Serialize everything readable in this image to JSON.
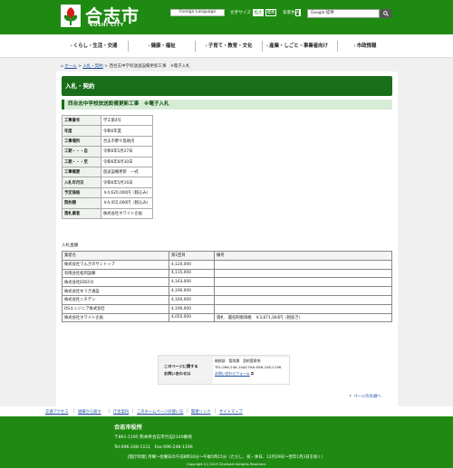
{
  "header": {
    "logo_name": "合志市",
    "logo_en": "KOSHI CITY",
    "foreign_language": "Foreign Language",
    "font_size_label": "文字サイズ",
    "font_enlarge": "拡大",
    "font_standard": "標準",
    "bg_color_label": "背景色",
    "bg_options": [
      "A",
      "A",
      "A"
    ],
    "search_placeholder": "Google 提供"
  },
  "nav": {
    "items": [
      "くらし・生活・交通",
      "健康・福祉",
      "子育て・教育・文化",
      "産業・しごと・事業者向け",
      "市政情報"
    ]
  },
  "breadcrumb": {
    "home": "ホーム",
    "level1": "入札・契約",
    "current": "西合志中学校放送設備更新工事　※電子入札"
  },
  "page": {
    "title": "入札・契約",
    "subtitle": "西合志中学校放送設備更新工事　※電子入札"
  },
  "info_table": [
    {
      "key": "工事番号",
      "value": "学工第4号"
    },
    {
      "key": "年度",
      "value": "令和6年度"
    },
    {
      "key": "工事場所",
      "value": "合志市野々島地内"
    },
    {
      "key": "工期・・・自",
      "value": "令和6年5月27日"
    },
    {
      "key": "工期・・・至",
      "value": "令和6年8月30日"
    },
    {
      "key": "工事概要",
      "value": "放送設備更新　一式"
    },
    {
      "key": "入札年月日",
      "value": "令和6年5月16日"
    },
    {
      "key": "予定価格",
      "value": "￥4,620,000円（税込み）"
    },
    {
      "key": "契約額",
      "value": "￥4,455,000円（税込み）"
    },
    {
      "key": "落札業者",
      "value": "株式会社ホワイト企画"
    }
  ],
  "bids": {
    "label": "入札金額",
    "headers": [
      "業者名",
      "第1回目",
      "備考"
    ],
    "rows": [
      {
        "name": "株式会社でんきのサントップ",
        "amount": "4,120,000",
        "note": ""
      },
      {
        "name": "有限会社松岡設備",
        "amount": "4,115,000",
        "note": ""
      },
      {
        "name": "株式会社EDECO",
        "amount": "4,163,000",
        "note": ""
      },
      {
        "name": "株式会社ゆうき通設",
        "amount": "4,190,000",
        "note": ""
      },
      {
        "name": "株式会社ニチデン",
        "amount": "4,160,000",
        "note": ""
      },
      {
        "name": "DSエンジニア株式会社",
        "amount": "4,190,000",
        "note": ""
      },
      {
        "name": "株式会社ホワイト企画",
        "amount": "4,050,000",
        "note": "落札　最低制限価格　￥3,871,364円（税抜き）"
      }
    ]
  },
  "contact": {
    "label_line1": "このページに関する",
    "label_line2": "お問い合わせは",
    "dept": "総務部　管財課　契約管財係",
    "tel": "TEL:096-248-1040 FAX:096-248-1196",
    "form_link": "お問い合わせフォーム"
  },
  "pagetop": "ページの先頭へ",
  "footer_links": [
    "交通アクセス",
    "組織から探す",
    "庁舎案内",
    "このホームページの使い方",
    "関連リンク",
    "サイトマップ"
  ],
  "footer": {
    "name": "合志市役所",
    "address": "〒861-1195  熊本県合志市竹迫2140番地",
    "tel": "Tel:096-248-1111　Fax:096-248-1196",
    "hours": "[開庁時間] 月曜〜金曜日の午前8時30分〜午後5時15分（ただし、祝・休日、12月29日〜翌年1月3日を除く）",
    "copyright": "Copyright (C) 2013 City.Koshi Allrights Reserved."
  },
  "colors": {
    "brand_green": "#1f8a12",
    "title_green": "#1a6e1a",
    "link_blue": "#1a4fa0"
  }
}
